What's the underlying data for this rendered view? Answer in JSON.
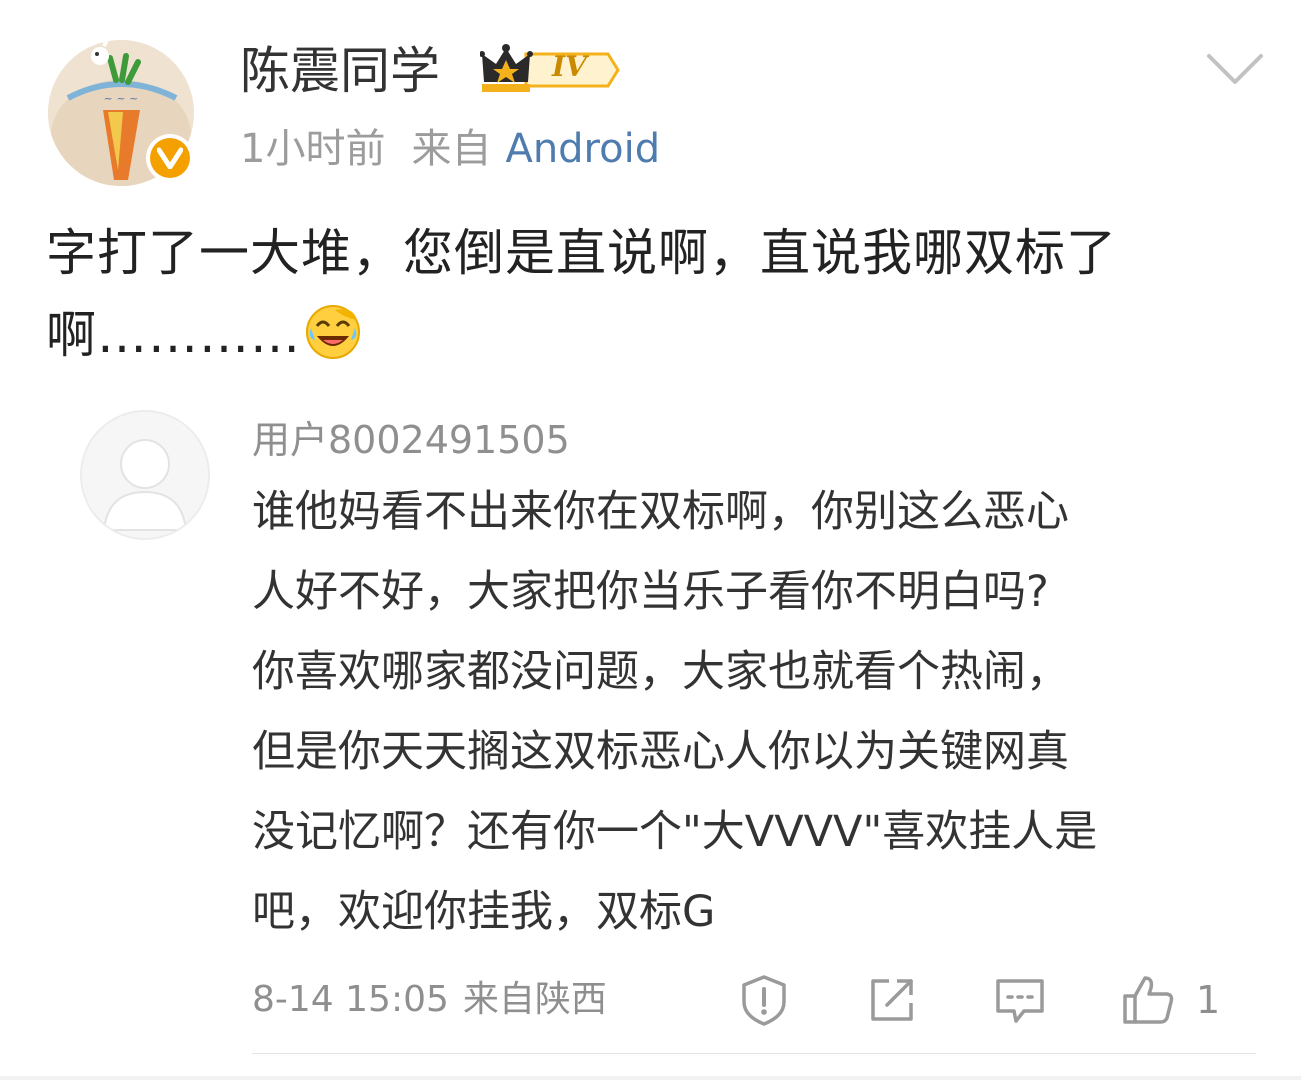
{
  "post": {
    "author": "陈震同学",
    "level_badge": "IV",
    "time": "1小时前",
    "from_label": "来自",
    "device": "Android",
    "text": "字打了一大堆，您倒是直说啊，直说我哪双标了啊…………",
    "emoji": "laugh-cry-emoji"
  },
  "reply": {
    "user": "用户8002491505",
    "lines": [
      "谁他妈看不出来你在双标啊，你别这么恶心",
      "人好不好，大家把你当乐子看你不明白吗?",
      "你喜欢哪家都没问题，大家也就看个热闹，",
      "但是你天天搁这双标恶心人你以为关键网真",
      "没记忆啊？还有你一个\"大VVVV\"喜欢挂人是",
      "吧，欢迎你挂我，双标G"
    ],
    "timestamp": "8-14 15:05",
    "location": "来自陕西",
    "like_count": "1"
  },
  "icons": {
    "collapse": "chevron-down-icon",
    "report": "report-icon",
    "share": "share-icon",
    "comment": "comment-icon",
    "like": "thumbs-up-icon"
  },
  "colors": {
    "link": "#4f7cae",
    "meta": "#9c9c9c",
    "verified": "#f4a100",
    "badge_gold": "#f3b21b"
  }
}
